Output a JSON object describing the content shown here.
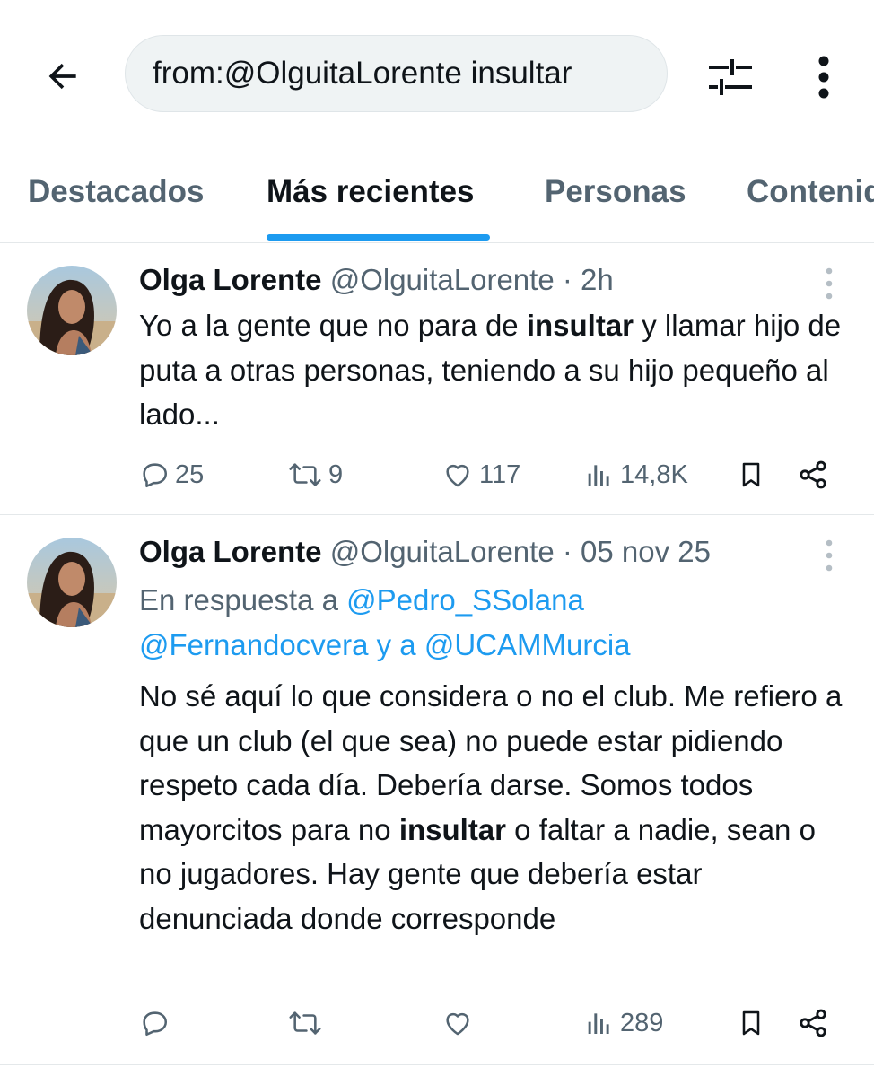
{
  "search": {
    "query": "from:@OlguitaLorente insultar"
  },
  "tabs": [
    {
      "label": "Destacados"
    },
    {
      "label": "Más recientes"
    },
    {
      "label": "Personas"
    },
    {
      "label": "Contenido"
    }
  ],
  "active_tab": "Más recientes",
  "tweets": [
    {
      "name": "Olga Lorente",
      "handle": "@OlguitaLorente",
      "sep": "·",
      "time": "2h",
      "body": {
        "t1": "Yo a la gente que no para de ",
        "b1": "insultar",
        "t2": " y llamar hijo de puta a otras personas, teniendo a su hijo pequeño al lado..."
      },
      "stats": {
        "replies": "25",
        "retweets": "9",
        "likes": "117",
        "views": "14,8K"
      }
    },
    {
      "name": "Olga Lorente",
      "handle": "@OlguitaLorente",
      "sep": "·",
      "time": "05 nov 25",
      "reply_prefix": "En respuesta a ",
      "reply_mention1": "@Pedro_SSolana",
      "reply_mention2": "@Fernandocvera",
      "reply_join": " y a ",
      "reply_mention3": "@UCAMMurcia",
      "body": {
        "t1": "No sé aquí lo que considera o no el club. Me refiero a que un club (el que sea) no puede estar pidiendo respeto cada día. Debería darse. Somos todos mayorcitos para no ",
        "b1": "insultar",
        "t2": " o faltar a nadie, sean o no jugadores. Hay gente que debería estar denunciada donde corresponde"
      },
      "stats": {
        "replies": "",
        "retweets": "",
        "likes": "",
        "views": "289"
      }
    }
  ],
  "colors": {
    "accent": "#1d9bf0",
    "muted": "#536471",
    "text": "#0f1419"
  },
  "icons": [
    "back-arrow-icon",
    "filter-sliders-icon",
    "more-vertical-icon",
    "reply-icon",
    "retweet-icon",
    "like-icon",
    "views-icon",
    "bookmark-icon",
    "share-icon"
  ]
}
